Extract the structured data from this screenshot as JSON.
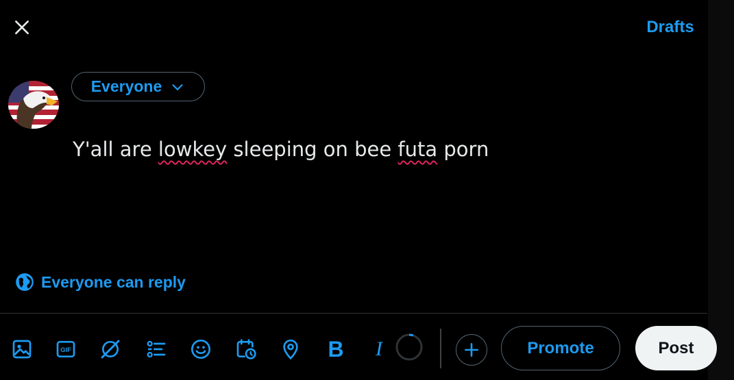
{
  "header": {
    "close_icon": "close-icon",
    "drafts_label": "Drafts"
  },
  "composer": {
    "audience_label": "Everyone",
    "text_parts": [
      "Y'all are ",
      "lowkey",
      " sleeping on bee ",
      "futa",
      " porn"
    ],
    "reply_setting_label": "Everyone can reply"
  },
  "toolbar": {
    "icons": [
      "media-icon",
      "gif-icon",
      "grok-icon",
      "poll-icon",
      "emoji-icon",
      "schedule-icon",
      "location-icon",
      "bold-icon",
      "italic-icon"
    ],
    "bold_glyph": "B",
    "italic_glyph": "I",
    "promote_label": "Promote",
    "post_label": "Post"
  },
  "colors": {
    "accent": "#1d9bf0",
    "background": "#000000",
    "text": "#e7e9ea",
    "border": "#536471",
    "post_button": "#eff3f4",
    "spellcheck": "#e0245e"
  }
}
